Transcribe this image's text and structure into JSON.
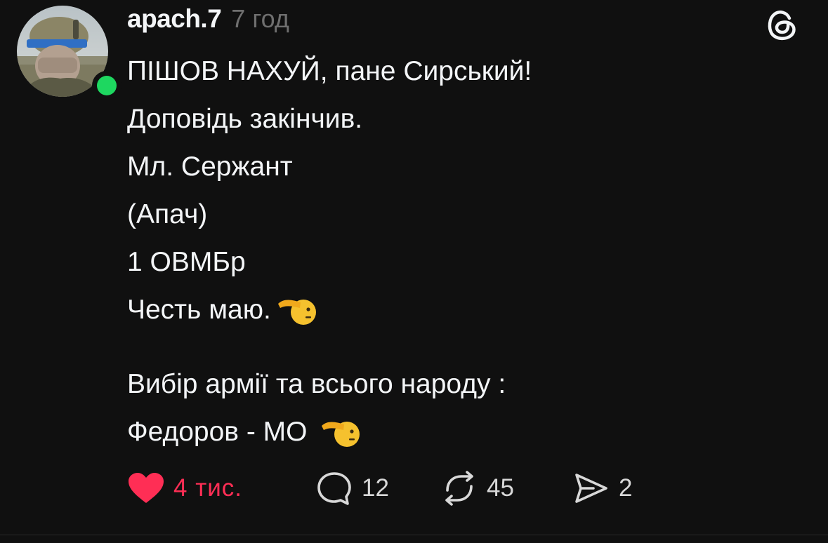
{
  "post": {
    "username": "apach.7",
    "timestamp": "7 год",
    "lines": [
      "ПІШОВ НАХУЙ, пане Сирський!",
      "Доповідь закінчив.",
      "Мл. Сержант",
      "(Апач)",
      "1 ОВМБр",
      "Честь маю.",
      "Вибір армії та всього народу :",
      "Федоров - МО"
    ],
    "emoji": "saluting-face"
  },
  "actions": {
    "likes": "4 тис.",
    "replies": "12",
    "reposts": "45",
    "shares": "2"
  },
  "colors": {
    "background": "#101010",
    "text": "#f3f5f7",
    "muted": "#6f6f6f",
    "like": "#ff2e55",
    "online": "#1ed760"
  },
  "icons": [
    "threads-logo-icon",
    "heart-icon",
    "comment-icon",
    "repost-icon",
    "share-icon",
    "saluting-face-emoji"
  ]
}
